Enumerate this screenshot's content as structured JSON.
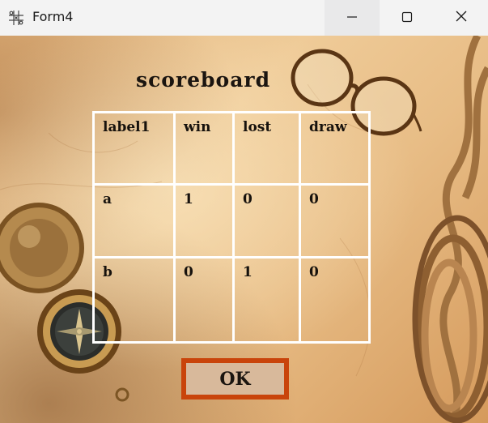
{
  "window": {
    "title": "Form4",
    "icon": "tic-tac-toe-grid-icon",
    "controls": [
      "minimize-icon",
      "maximize-icon",
      "close-icon"
    ]
  },
  "form": {
    "heading": "scoreboard",
    "table": {
      "headers": [
        "label1",
        "win",
        "lost",
        "draw"
      ],
      "rows": [
        [
          "a",
          "1",
          "0",
          "0"
        ],
        [
          "b",
          "0",
          "1",
          "0"
        ]
      ]
    },
    "ok_label": "OK"
  },
  "colors": {
    "titlebar": "#f3f3f3",
    "grid_lines": "#ffffff",
    "ok_border": "#c9440b",
    "ok_fill": "#d8b99b",
    "text": "#1b1510"
  }
}
